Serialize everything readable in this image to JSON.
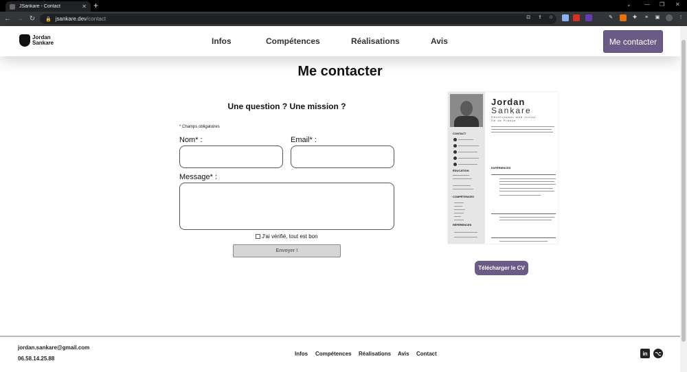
{
  "browser": {
    "tab_title": "JSankare - Contact",
    "url_host": "jsankare.dev",
    "url_path": "/contact",
    "new_tab": "+"
  },
  "header": {
    "logo_line1": "Jordan",
    "logo_line2": "Sankare",
    "nav": [
      "Infos",
      "Compétences",
      "Réalisations",
      "Avis"
    ],
    "cta_label": "Me contacter"
  },
  "page": {
    "title": "Me contacter"
  },
  "form": {
    "heading": "Une question ? Une mission ?",
    "required_note": "* Champs obligatoires",
    "name_label": "Nom* :",
    "email_label": "Email* :",
    "message_label": "Message* :",
    "checkbox_label": "J'ai vérifié, tout est bon",
    "submit_label": "Envoyer !"
  },
  "cv": {
    "name_first": "Jordan",
    "name_last": "Sankare",
    "role": "Développeur web Junior",
    "location": "Île de France",
    "contact_heading": "CONTACT",
    "education_heading": "ÉDUCATION",
    "skills_heading": "COMPÉTENCES",
    "references_heading": "RÉFÉRENCES",
    "experience_heading": "EXPÉRIENCES",
    "download_label": "Télécharger le CV"
  },
  "footer": {
    "email": "jordan.sankare@gmail.com",
    "phone": "06.58.14.25.88",
    "links": [
      "Infos",
      "Compétences",
      "Réalisations",
      "Avis",
      "Contact"
    ],
    "social": [
      "in",
      "⌥"
    ]
  },
  "colors": {
    "accent": "#6b5b87",
    "text": "#111111"
  }
}
